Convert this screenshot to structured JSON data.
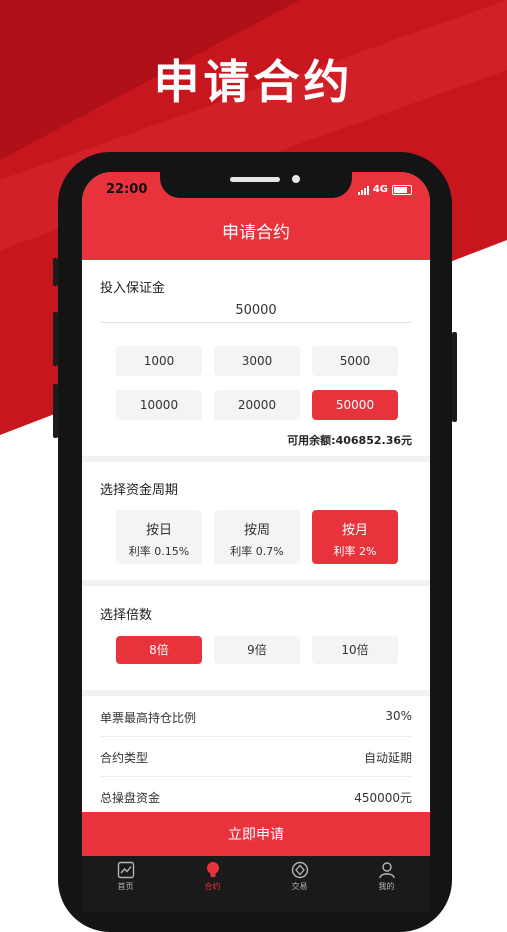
{
  "promo": {
    "title": "申请合约"
  },
  "status": {
    "time": "22:00",
    "network": "4G"
  },
  "header": {
    "title": "申请合约"
  },
  "deposit": {
    "title": "投入保证金",
    "input_value": "50000",
    "options": [
      "1000",
      "3000",
      "5000",
      "10000",
      "20000",
      "50000"
    ],
    "selected": "50000",
    "balance_text": "可用余额:406852.36元"
  },
  "period": {
    "title": "选择资金周期",
    "options": [
      {
        "name": "按日",
        "rate": "利率 0.15%"
      },
      {
        "name": "按周",
        "rate": "利率 0.7%"
      },
      {
        "name": "按月",
        "rate": "利率 2%"
      }
    ],
    "selected": "按月"
  },
  "multiple": {
    "title": "选择倍数",
    "options": [
      "8倍",
      "9倍",
      "10倍"
    ],
    "selected": "8倍"
  },
  "info": {
    "rows": [
      {
        "label": "单票最高持仓比例",
        "value": "30%"
      },
      {
        "label": "合约类型",
        "value": "自动延期"
      },
      {
        "label": "总操盘资金",
        "value": "450000元"
      }
    ]
  },
  "submit_label": "立即申请",
  "tabs": [
    {
      "label": "首页",
      "icon": "chart-icon"
    },
    {
      "label": "合约",
      "icon": "bulb-icon"
    },
    {
      "label": "交易",
      "icon": "trade-icon"
    },
    {
      "label": "我的",
      "icon": "user-icon"
    }
  ],
  "active_tab": "合约",
  "colors": {
    "accent": "#e8333d",
    "background_red": "#c8161e",
    "tabbar": "#1a1a1a"
  }
}
